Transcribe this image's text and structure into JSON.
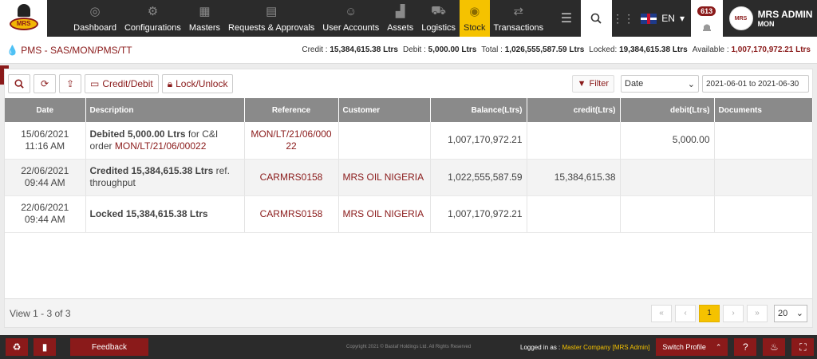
{
  "header": {
    "logo_text": "MRS",
    "nav": [
      {
        "label": "Dashboard",
        "icon": "dashboard-icon"
      },
      {
        "label": "Configurations",
        "icon": "gears-icon"
      },
      {
        "label": "Masters",
        "icon": "building-icon"
      },
      {
        "label": "Requests & Approvals",
        "icon": "document-check-icon"
      },
      {
        "label": "User Accounts",
        "icon": "users-icon"
      },
      {
        "label": "Assets",
        "icon": "factory-icon"
      },
      {
        "label": "Logistics",
        "icon": "truck-icon"
      },
      {
        "label": "Stock",
        "icon": "coins-icon",
        "active": true
      },
      {
        "label": "Transactions",
        "icon": "exchange-icon"
      }
    ],
    "lang": "EN",
    "notifications": "613",
    "user": {
      "name": "MRS ADMIN",
      "role": "MON",
      "avatar_text": "MRS"
    }
  },
  "infobar": {
    "breadcrumb": "PMS - SAS/MON/PMS/TT",
    "credit_label": "Credit :",
    "credit": "15,384,615.38 Ltrs",
    "debit_label": "Debit :",
    "debit": "5,000.00 Ltrs",
    "total_label": "Total :",
    "total": "1,026,555,587.59 Ltrs",
    "locked_label": "Locked:",
    "locked": "19,384,615.38 Ltrs",
    "available_label": "Available :",
    "available": "1,007,170,972.21 Ltrs"
  },
  "toolbar": {
    "credit_debit": "Credit/Debit",
    "lock_unlock": "Lock/Unlock",
    "filter": "Filter",
    "filter_field": "Date",
    "date_range": "2021-06-01 to 2021-06-30"
  },
  "table": {
    "columns": [
      "Date",
      "Description",
      "Reference",
      "Customer",
      "Balance(Ltrs)",
      "credit(Ltrs)",
      "debit(Ltrs)",
      "Documents"
    ],
    "rows": [
      {
        "date": "15/06/2021",
        "time": "11:16 AM",
        "desc_bold": "Debited 5,000.00 Ltrs",
        "desc_rest": " for C&I order ",
        "desc_link": "MON/LT/21/06/00022",
        "reference": "MON/LT/21/06/00022",
        "customer": "",
        "balance": "1,007,170,972.21",
        "credit": "",
        "debit": "5,000.00",
        "documents": ""
      },
      {
        "date": "22/06/2021",
        "time": "09:44 AM",
        "desc_bold": "Credited 15,384,615.38 Ltrs",
        "desc_rest": " ref. throughput",
        "desc_link": "",
        "reference": "CARMRS0158",
        "customer": "MRS OIL NIGERIA",
        "balance": "1,022,555,587.59",
        "credit": "15,384,615.38",
        "debit": "",
        "documents": ""
      },
      {
        "date": "22/06/2021",
        "time": "09:44 AM",
        "desc_bold": "Locked 15,384,615.38 Ltrs",
        "desc_rest": "",
        "desc_link": "",
        "reference": "CARMRS0158",
        "customer": "MRS OIL NIGERIA",
        "balance": "1,007,170,972.21",
        "credit": "",
        "debit": "",
        "documents": ""
      }
    ]
  },
  "pager": {
    "info": "View 1 - 3 of 3",
    "current": "1",
    "page_size": "20"
  },
  "footer": {
    "feedback": "Feedback",
    "copyright": "Copyright 2021 © Bastaf Holdings Ltd. All Rights Reserved",
    "logged_label": "Logged in as :",
    "logged_value": "Master Company [MRS Admin]",
    "switch_profile": "Switch Profile"
  },
  "colors": {
    "brand": "#8a1a1a",
    "accent": "#f5c200",
    "topbar": "#2b2b2b"
  }
}
